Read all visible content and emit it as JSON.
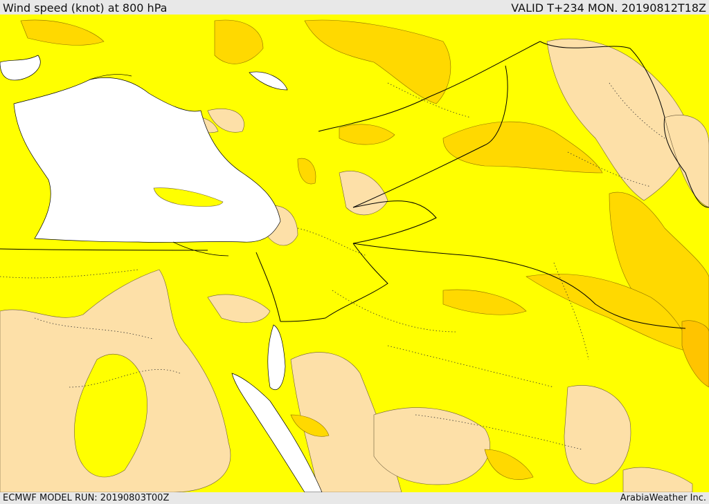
{
  "header": {
    "title": "Wind speed (knot) at 800 hPa",
    "valid": "VALID T+234 MON. 20190812T18Z"
  },
  "footer": {
    "model_run": "ECMWF MODEL RUN: 20190803T00Z",
    "credit": "ArabiaWeather Inc."
  },
  "colors": {
    "sea": "#ffffff",
    "level_low": "#fde0a8",
    "level_mid": "#ffff00",
    "level_high": "#ffd900",
    "level_higher": "#ffc400",
    "border": "#000000"
  }
}
